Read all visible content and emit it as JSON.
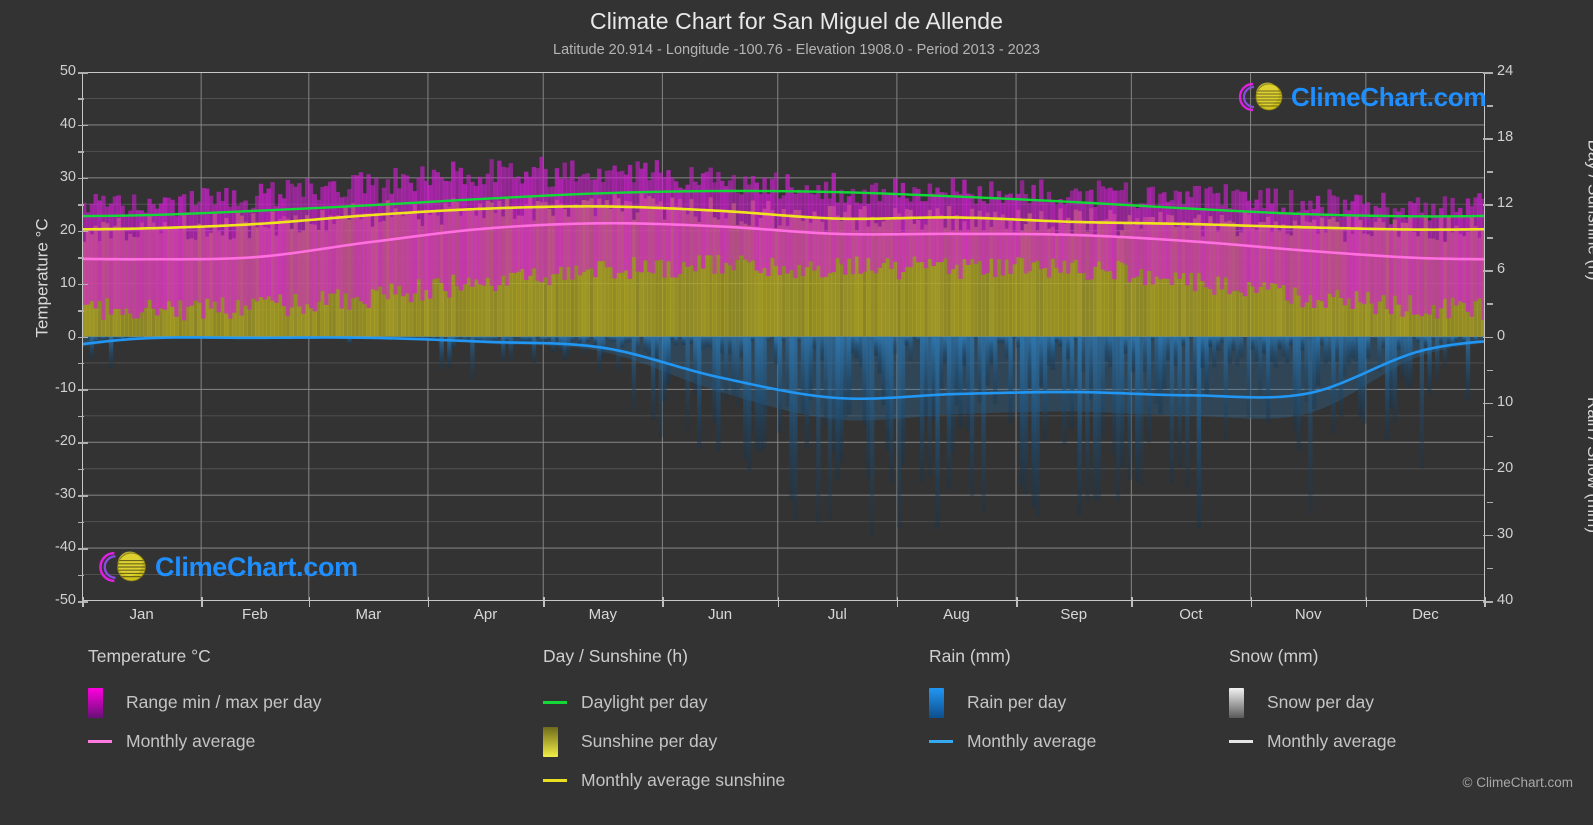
{
  "header": {
    "title": "Climate Chart for San Miguel de Allende",
    "subtitle": "Latitude 20.914 - Longitude -100.76 - Elevation 1908.0 - Period 2013 - 2023"
  },
  "branding": {
    "logo_text": "ClimeChart.com",
    "copyright": "© ClimeChart.com"
  },
  "axes": {
    "left_label": "Temperature °C",
    "right_top_label": "Day / Sunshine (h)",
    "right_bottom_label": "Rain / Snow (mm)",
    "left_ticks": [
      50,
      40,
      30,
      20,
      10,
      0,
      -10,
      -20,
      -30,
      -40,
      -50
    ],
    "right_top_ticks": [
      24,
      18,
      12,
      6,
      0
    ],
    "right_bottom_ticks": [
      10,
      20,
      30,
      40
    ],
    "x_ticks": [
      "Jan",
      "Feb",
      "Mar",
      "Apr",
      "May",
      "Jun",
      "Jul",
      "Aug",
      "Sep",
      "Oct",
      "Nov",
      "Dec"
    ]
  },
  "legend": {
    "columns": [
      {
        "title": "Temperature °C",
        "items": [
          {
            "label": "Range min / max per day",
            "marker": "gradient-box",
            "color": "#ff00e0",
            "color2": "#6a0f78"
          },
          {
            "label": "Monthly average",
            "marker": "line",
            "color": "#ff7ae0"
          }
        ]
      },
      {
        "title": "Day / Sunshine (h)",
        "items": [
          {
            "label": "Daylight per day",
            "marker": "line",
            "color": "#12d937"
          },
          {
            "label": "Sunshine per day",
            "marker": "gradient-box",
            "color": "#6e6a1a",
            "color2": "#f2ee46"
          },
          {
            "label": "Monthly average sunshine",
            "marker": "line",
            "color": "#e8e020"
          }
        ]
      },
      {
        "title": "Rain (mm)",
        "items": [
          {
            "label": "Rain per day",
            "marker": "gradient-box",
            "color": "#2196f3",
            "color2": "#0d4f8c"
          },
          {
            "label": "Monthly average",
            "marker": "line",
            "color": "#35a8f0"
          }
        ]
      },
      {
        "title": "Snow (mm)",
        "items": [
          {
            "label": "Snow per day",
            "marker": "gradient-box",
            "color": "#f2f2f2",
            "color2": "#5a5a5a"
          },
          {
            "label": "Monthly average",
            "marker": "line",
            "color": "#e6e6e6"
          }
        ]
      }
    ]
  },
  "colors": {
    "background": "#333333",
    "grid": "#777777",
    "axis": "#c8c8c8",
    "text": "#d8d8d8",
    "temp_range": "#c418c4",
    "temp_avg_line": "#ff6fe0",
    "daylight_line": "#12d937",
    "sunshine_band": "#9a9620",
    "sunshine_avg_line": "#f0e41e",
    "rain_band": "#1b5a8a",
    "rain_avg_line": "#2196f3",
    "logo_blue": "#1f8fff",
    "logo_magenta": "#e020e0",
    "logo_yellow": "#d4c81e"
  },
  "chart_data": {
    "type": "line",
    "title": "Climate Chart for San Miguel de Allende",
    "subtitle": "Latitude 20.914 - Longitude -100.76 - Elevation 1908.0 - Period 2013 - 2023",
    "xlabel": "",
    "ylabel": "Temperature °C",
    "ylim": [
      -50,
      50
    ],
    "y2_top_label": "Day / Sunshine (h)",
    "y2_top_lim": [
      0,
      24
    ],
    "y2_bottom_label": "Rain / Snow (mm)",
    "y2_bottom_lim": [
      0,
      40
    ],
    "grid": true,
    "legend_position": "below",
    "categories": [
      "Jan",
      "Feb",
      "Mar",
      "Apr",
      "May",
      "Jun",
      "Jul",
      "Aug",
      "Sep",
      "Oct",
      "Nov",
      "Dec"
    ],
    "series": [
      {
        "name": "Monthly average temperature",
        "unit": "°C",
        "color": "#ff6fe0",
        "axis": "left",
        "values": [
          14.6,
          15.0,
          17.8,
          20.4,
          21.4,
          20.8,
          19.4,
          19.4,
          19.2,
          18.0,
          16.2,
          14.8
        ]
      },
      {
        "name": "Daily maximum temperature (range top)",
        "unit": "°C",
        "color": "#c418c4",
        "axis": "left",
        "values": [
          25.0,
          26.5,
          29.0,
          31.0,
          31.5,
          29.5,
          27.5,
          27.5,
          27.0,
          26.5,
          25.5,
          24.5
        ]
      },
      {
        "name": "Daily minimum temperature (range bottom)",
        "unit": "°C",
        "color": "#c418c4",
        "axis": "left",
        "values": [
          5.0,
          5.5,
          7.5,
          10.5,
          12.5,
          13.5,
          13.0,
          13.0,
          12.8,
          10.5,
          7.5,
          5.5
        ]
      },
      {
        "name": "Daylight per day",
        "unit": "h",
        "color": "#12d937",
        "axis": "right-top",
        "values": [
          11.0,
          11.4,
          11.9,
          12.5,
          13.0,
          13.2,
          13.1,
          12.7,
          12.2,
          11.6,
          11.1,
          10.9
        ]
      },
      {
        "name": "Monthly average sunshine",
        "unit": "h",
        "color": "#f0e41e",
        "axis": "right-top",
        "values": [
          9.8,
          10.2,
          11.0,
          11.6,
          11.8,
          11.4,
          10.7,
          10.8,
          10.4,
          10.2,
          9.9,
          9.7
        ]
      },
      {
        "name": "Monthly average rain",
        "unit": "mm",
        "color": "#2196f3",
        "axis": "right-bottom",
        "values": [
          0.3,
          0.2,
          0.2,
          0.8,
          1.7,
          6.2,
          9.3,
          8.7,
          8.4,
          8.9,
          8.6,
          2.0
        ]
      }
    ],
    "notes": "Daily min/max temperature range shown as magenta vertical bars; sunshine hours per day as olive/yellow bars; daily rain as blue downward bars on inverted lower-right axis."
  }
}
